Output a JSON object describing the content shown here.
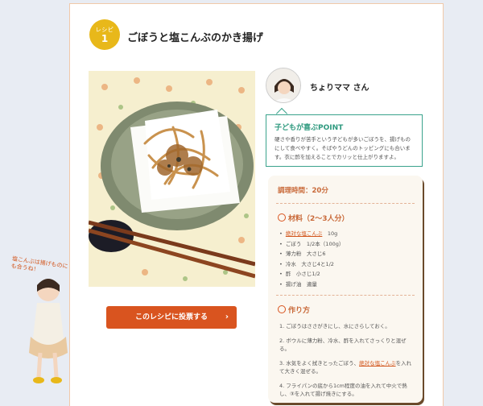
{
  "recipe": {
    "badge_label": "レシピ",
    "badge_number": "1",
    "title": "ごぼうと塩こんぶのかき揚げ"
  },
  "kid_caption": "塩こんぶは揚げものにも合うね！",
  "vote_button": {
    "label": "このレシピに投票する",
    "chevron": "›"
  },
  "chef": {
    "name": "ちょりママ さん"
  },
  "point": {
    "heading": "子どもが喜ぶPOINT",
    "body": "硬さや香りが苦手という子どもが多いごぼうを、揚げものにして食べやすく。そばやうどんのトッピングにも合います。衣に酢を加えることでカリッと仕上がりますよ。"
  },
  "cook_time": "調理時間：20分",
  "ingredients": {
    "heading": "材料（2〜3人分）",
    "items": [
      {
        "link": "絶対な塩こんぶ",
        "text": "　10g"
      },
      {
        "link": "",
        "text": "ごぼう　1/2本（100g）"
      },
      {
        "link": "",
        "text": "薄力粉　大さじ6"
      },
      {
        "link": "",
        "text": "冷水　大さじ4と1/2"
      },
      {
        "link": "",
        "text": "酢　小さじ1/2"
      },
      {
        "link": "",
        "text": "揚げ油　適量"
      }
    ]
  },
  "method": {
    "heading": "作り方",
    "steps": [
      {
        "pre": "1. ごぼうはささがきにし、水にさらしておく。",
        "link": "",
        "post": ""
      },
      {
        "pre": "2. ボウルに薄力粉、冷水、酢を入れてさっくりと混ぜる。",
        "link": "",
        "post": ""
      },
      {
        "pre": "3. 水気をよく拭きとったごぼう、",
        "link": "絶対な塩こんぶ",
        "post": "を入れて大きく混ぜる。"
      },
      {
        "pre": "4. フライパンの底から1cm程度の油を入れて中火で熱し、③を入れて揚げ焼きにする。",
        "link": "",
        "post": ""
      }
    ]
  },
  "colors": {
    "accent": "#d9541f",
    "badge": "#e8b81a",
    "point_border": "#3aa38c",
    "card_shadow": "#6b4a2b"
  }
}
